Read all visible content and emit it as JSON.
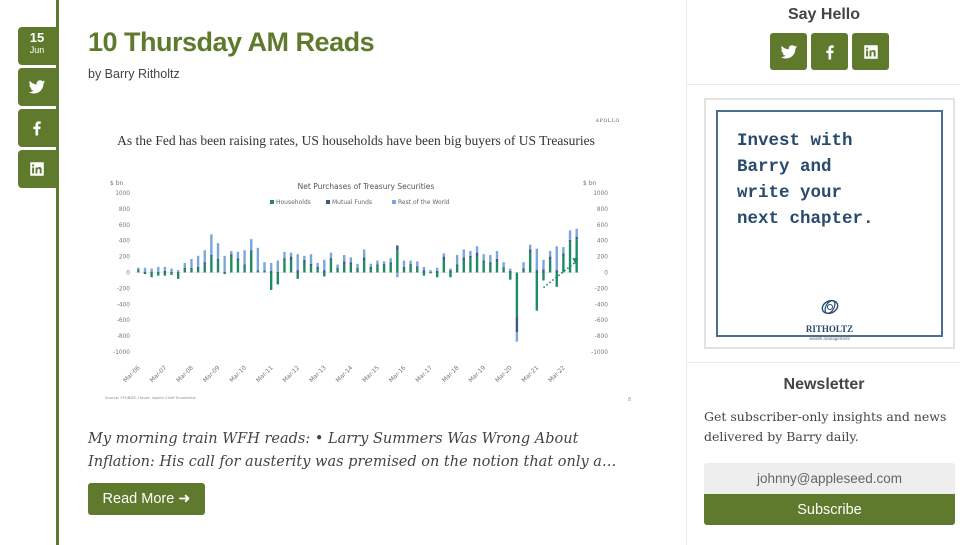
{
  "post": {
    "date_day": "15",
    "date_month": "Jun",
    "title": "10 Thursday AM Reads",
    "byline": "by Barry Ritholtz",
    "excerpt": "My morning train WFH reads: • Larry Summers Was Wrong About Inflation: His call for austerity was premised on the notion that only a…",
    "read_more_label": "Read More ➜"
  },
  "share_rail": {
    "icons": [
      "twitter-icon",
      "facebook-icon",
      "linkedin-icon"
    ]
  },
  "sidebar": {
    "say_hello_title": "Say Hello",
    "social_icons": [
      "twitter-icon",
      "facebook-icon",
      "linkedin-icon"
    ],
    "ad": {
      "text": "Invest with\nBarry and\nwrite your\nnext chapter.",
      "logo_name": "RITHOLTZ",
      "logo_sub": "wealth management"
    },
    "newsletter": {
      "title": "Newsletter",
      "description": "Get subscriber-only insights and news delivered by Barry daily.",
      "email_placeholder": "johnny@appleseed.com",
      "subscribe_label": "Subscribe"
    }
  },
  "colors": {
    "brand_green": "#5f7a2d",
    "households": "#1f8a64",
    "mutual_funds": "#3c5a80",
    "rest_of_world": "#79a7dd"
  },
  "chart_data": {
    "type": "bar",
    "stacked": true,
    "brand": "APOLLO",
    "headline": "As the Fed has been raising rates, US households have been big buyers of US Treasuries",
    "title": "Net Purchases of Treasury Securities",
    "ylabel_left": "$ bn",
    "ylabel_right": "$ bn",
    "ylim": [
      -1000,
      1000
    ],
    "yticks": [
      1000,
      800,
      600,
      400,
      200,
      0,
      -200,
      -400,
      -600,
      -800,
      -1000
    ],
    "xtick_labels": [
      "Mar-06",
      "Mar-07",
      "Mar-08",
      "Mar-09",
      "Mar-10",
      "Mar-11",
      "Mar-12",
      "Mar-13",
      "Mar-14",
      "Mar-15",
      "Mar-16",
      "Mar-17",
      "Mar-18",
      "Mar-19",
      "Mar-20",
      "Mar-21",
      "Mar-22"
    ],
    "legend": [
      "Households",
      "Mutual Funds",
      "Rest of the World"
    ],
    "legend_position": "top-center",
    "source": "Source: FFUNDS, Haver, Apollo Chief Economist",
    "page_marker": "8",
    "annotation": "dotted arrow showing rising household purchases through 2022",
    "series": [
      {
        "name": "Households",
        "values": [
          30,
          -20,
          -60,
          -40,
          -40,
          -30,
          -80,
          40,
          40,
          50,
          100,
          200,
          150,
          -20,
          200,
          150,
          80,
          250,
          20,
          20,
          -220,
          -150,
          150,
          150,
          -80,
          120,
          80,
          50,
          -50,
          150,
          40,
          100,
          100,
          40,
          150,
          50,
          80,
          90,
          100,
          280,
          50,
          90,
          60,
          -40,
          -10,
          -60,
          150,
          -60,
          80,
          150,
          180,
          200,
          120,
          100,
          130,
          60,
          -90,
          -550,
          30,
          250,
          -480,
          -100,
          160,
          -180,
          200,
          380,
          420
        ]
      },
      {
        "name": "Mutual Funds",
        "values": [
          10,
          10,
          10,
          10,
          20,
          10,
          10,
          20,
          20,
          20,
          30,
          20,
          20,
          10,
          30,
          30,
          20,
          30,
          10,
          10,
          20,
          10,
          30,
          50,
          30,
          40,
          30,
          20,
          30,
          30,
          20,
          40,
          30,
          20,
          40,
          20,
          20,
          20,
          30,
          60,
          20,
          20,
          20,
          30,
          10,
          20,
          50,
          30,
          20,
          40,
          30,
          50,
          30,
          30,
          40,
          10,
          20,
          -200,
          20,
          40,
          30,
          40,
          40,
          30,
          40,
          30,
          30
        ]
      },
      {
        "name": "Rest of the World",
        "values": [
          20,
          50,
          40,
          60,
          50,
          40,
          20,
          60,
          110,
          140,
          150,
          260,
          200,
          200,
          40,
          80,
          180,
          140,
          280,
          100,
          100,
          140,
          80,
          50,
          200,
          50,
          120,
          50,
          130,
          70,
          40,
          80,
          60,
          50,
          100,
          40,
          50,
          30,
          50,
          -60,
          80,
          40,
          60,
          40,
          20,
          40,
          40,
          20,
          120,
          100,
          60,
          80,
          80,
          90,
          100,
          60,
          30,
          -120,
          80,
          60,
          270,
          120,
          70,
          300,
          80,
          120,
          100
        ]
      }
    ]
  }
}
